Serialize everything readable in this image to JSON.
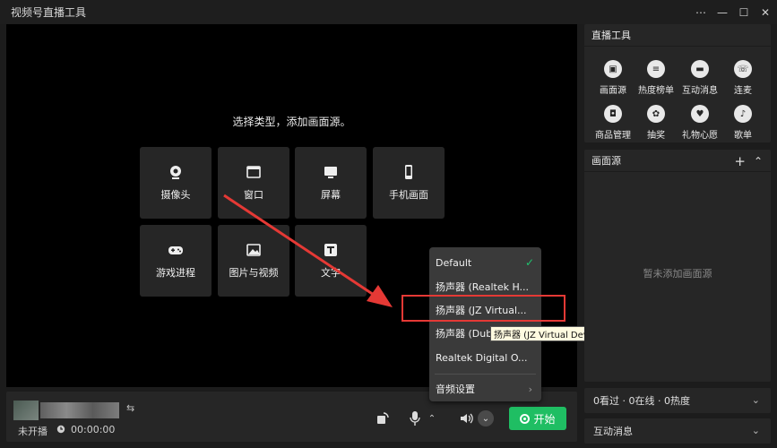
{
  "window": {
    "title": "视频号直播工具",
    "more_icon": "⋯",
    "min_icon": "—",
    "max_icon": "☐",
    "close_icon": "✕"
  },
  "preview": {
    "prompt": "选择类型，添加画面源。",
    "sources": [
      {
        "label": "摄像头",
        "icon": "camera-icon"
      },
      {
        "label": "窗口",
        "icon": "window-icon"
      },
      {
        "label": "屏幕",
        "icon": "screen-icon"
      },
      {
        "label": "手机画面",
        "icon": "phone-icon"
      },
      {
        "label": "游戏进程",
        "icon": "gamepad-icon"
      },
      {
        "label": "图片与视频",
        "icon": "image-icon"
      },
      {
        "label": "文字",
        "icon": "text-icon"
      }
    ]
  },
  "audio_menu": {
    "items": [
      {
        "label": "Default",
        "checked": true
      },
      {
        "label": "扬声器 (Realtek H..."
      },
      {
        "label": "扬声器 (JZ Virtual..."
      },
      {
        "label": "扬声器 (Dubb"
      },
      {
        "label": "Realtek Digital O..."
      }
    ],
    "settings_label": "音频设置",
    "tooltip": "扬声器 (JZ Virtual Device)"
  },
  "bottom": {
    "status": "未开播",
    "time": "00:00:00",
    "start_label": "开始",
    "swap_icon": "⇆"
  },
  "tools_panel": {
    "title": "直播工具",
    "tools": [
      {
        "label": "画面源",
        "icon": "scene-icon"
      },
      {
        "label": "热度榜单",
        "icon": "list-icon"
      },
      {
        "label": "互动消息",
        "icon": "message-icon"
      },
      {
        "label": "连麦",
        "icon": "call-icon"
      },
      {
        "label": "商品管理",
        "icon": "shop-bag-icon"
      },
      {
        "label": "抽奖",
        "icon": "lottery-icon"
      },
      {
        "label": "礼物心愿",
        "icon": "gift-heart-icon"
      },
      {
        "label": "歌单",
        "icon": "music-icon"
      }
    ]
  },
  "scene_panel": {
    "title": "画面源",
    "add_icon": "+",
    "collapse_icon": "⌃",
    "empty": "暂未添加画面源"
  },
  "stats": {
    "text": "0看过 · 0在线 · 0热度"
  },
  "messages": {
    "title": "互动消息"
  },
  "colors": {
    "accent": "#1fbe63",
    "highlight": "#e53935"
  }
}
